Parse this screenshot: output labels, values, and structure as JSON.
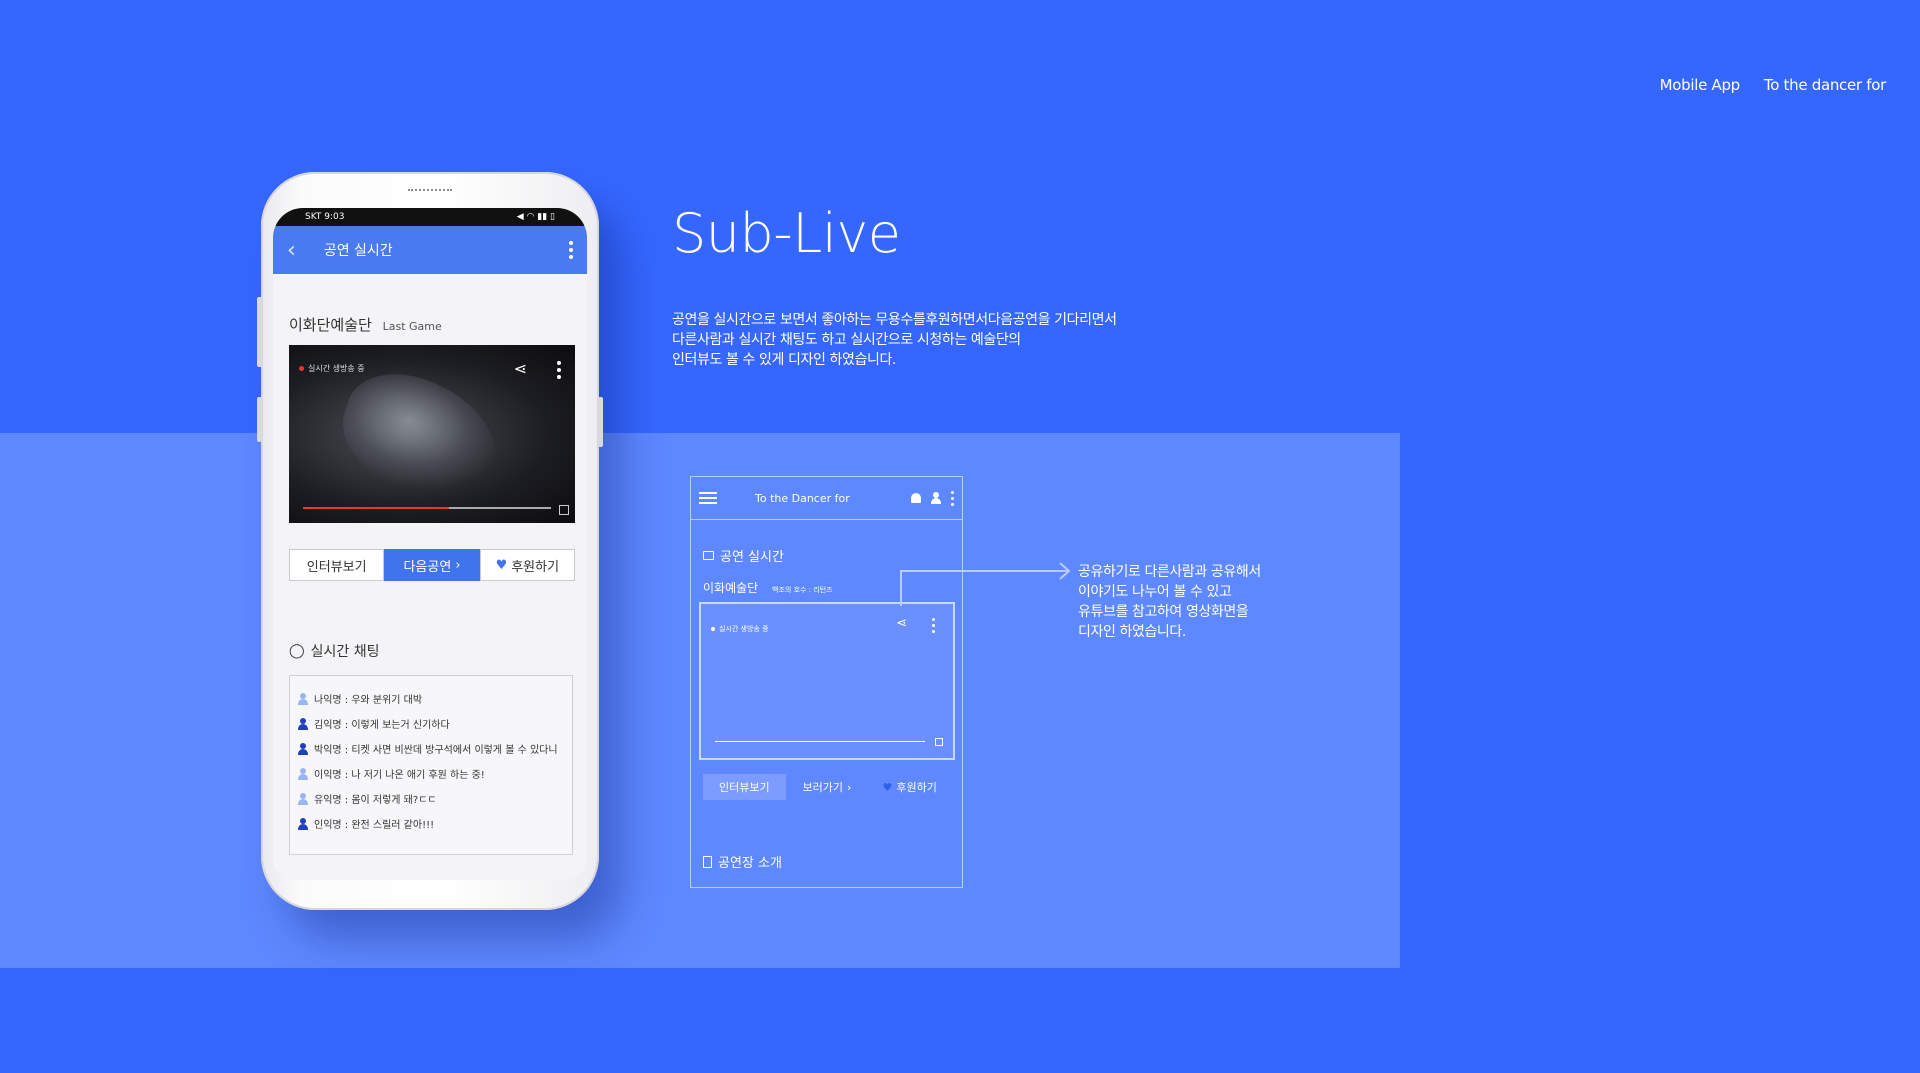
{
  "nav": {
    "items": [
      "Mobile App",
      "To the dancer for"
    ]
  },
  "phone": {
    "status": {
      "carrier": "SKT  9:03",
      "icons": "◀ ◠ ▮▮ ▯"
    },
    "header": {
      "title": "공연 실시간"
    },
    "troupe": {
      "name": "이화단예술단",
      "tag": "Last Game"
    },
    "video": {
      "live_label": "실시간 생방송 중",
      "progress": 0.59
    },
    "tabs": {
      "interview": "인터뷰보기",
      "next": "다음공연",
      "support": "후원하기"
    },
    "chat": {
      "title": "실시간 채팅",
      "messages": [
        {
          "text": "나익명 : 우와 분위기 대박",
          "color": "#9ab6f2"
        },
        {
          "text": "김익명 : 이렇게 보는거 신기하다",
          "color": "#1f3fbf"
        },
        {
          "text": "박익명 : 티켓 사면 비싼데 방구석에서 이렇게 볼 수 있다니",
          "color": "#1f3fbf"
        },
        {
          "text": "이익명 : 나 저기 나온 애기 후원 하는 중!",
          "color": "#9ab6f2"
        },
        {
          "text": "유익명 : 몸이 저렇게 돼?ㄷㄷ",
          "color": "#9ab6f2"
        },
        {
          "text": "인익명 : 완전 스릴러 같아!!!",
          "color": "#1f3fbf"
        }
      ]
    }
  },
  "section": {
    "title": "Sub-Live",
    "description": [
      "공연을 실시간으로 보면서 좋아하는 무용수를후원하면서다음공연을 기다리면서",
      "다른사람과 실시간 채팅도 하고 실시간으로 시청하는 예술단의",
      "인터뷰도 볼 수 있게 디자인 하였습니다."
    ]
  },
  "wireframe": {
    "header_title": "To the Dancer for",
    "live_section": "공연 실시간",
    "troupe": {
      "name": "이화예술단",
      "tag": "백조의 호수 : 리턴즈"
    },
    "live_label": "실시간 생방송 중",
    "tabs": {
      "interview": "인터뷰보기",
      "watch": "보러가기",
      "support": "후원하기"
    },
    "venue_section": "공연장 소개"
  },
  "callout": {
    "lines": [
      "공유하기로 다른사람과 공유해서",
      "이야기도 나누어 볼 수 있고",
      "유튜브를 참고하여 영상화면을",
      "디자인 하였습니다."
    ]
  },
  "colors": {
    "background": "#3567ff",
    "band": "#5e88ff",
    "accent": "#3f74ec"
  }
}
